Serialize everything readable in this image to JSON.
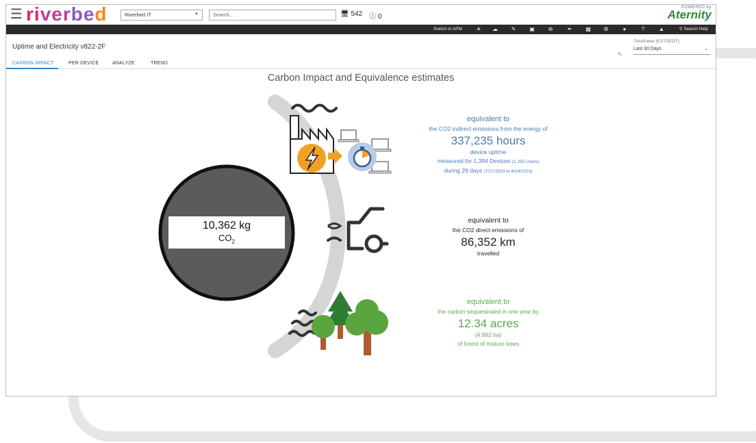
{
  "app": {
    "logo_text": [
      "ri",
      "ver",
      "be",
      "d"
    ],
    "org_select_value": "Riverbed IT",
    "search_placeholder": "Search...",
    "device_count": "542",
    "alert_count": "0",
    "powered_by": "POWERED by",
    "brand": "Aternity"
  },
  "toolbar": {
    "switch_label": "Switch to APM",
    "icons": [
      "lightbulb-icon",
      "cloud-icon",
      "pencil-icon",
      "save-icon",
      "fullscreen-icon",
      "pen-icon",
      "clipboard-icon",
      "gear-icon",
      "user-icon",
      "help-icon",
      "megaphone-icon"
    ],
    "search_help_label": "Search Help"
  },
  "page": {
    "title": "Uptime and Electricity v822-2F",
    "timeframe_label": "Timeframe (ESTSEDT)",
    "timeframe_value": "Last 30 Days",
    "tabs": [
      "CARBON IMPACT",
      "PER DEVICE",
      "ANALYZE",
      "TREND"
    ],
    "active_tab": "CARBON IMPACT"
  },
  "content": {
    "heading": "Carbon Impact and Equivalence estimates",
    "co2_value": "10,362 kg",
    "co2_unit_main": "CO",
    "co2_unit_sub": "2",
    "energy": {
      "equivalent_to": "equivalent to",
      "desc": "the CO2 indirect emissions from the energy of",
      "value": "337,235 hours",
      "label": "device uptime",
      "measured": "measured for 1,394 Devices",
      "measured_users": "(1,295 Users)",
      "period": "during 29 days",
      "period_dates": "(7/27/2023 to 8/24/2023)"
    },
    "car": {
      "equivalent_to": "equivalent to",
      "desc": "the CO2 direct emissions of",
      "value": "86,352 km",
      "label": "travelled"
    },
    "forest": {
      "equivalent_to": "equivalent to",
      "desc": "the  carbon sequestrated in one year by",
      "value": "12.34 acres",
      "sub": "(4.992 ha)",
      "label": "of forest of mature trees"
    }
  },
  "colors": {
    "toolbar_bg": "#2b2b2b",
    "accent_blue": "#3b86c6",
    "energy_blue": "#4a79b5",
    "forest_green": "#5ba84d",
    "orange": "#f0a125",
    "circle_gray": "#5b5b5b"
  }
}
